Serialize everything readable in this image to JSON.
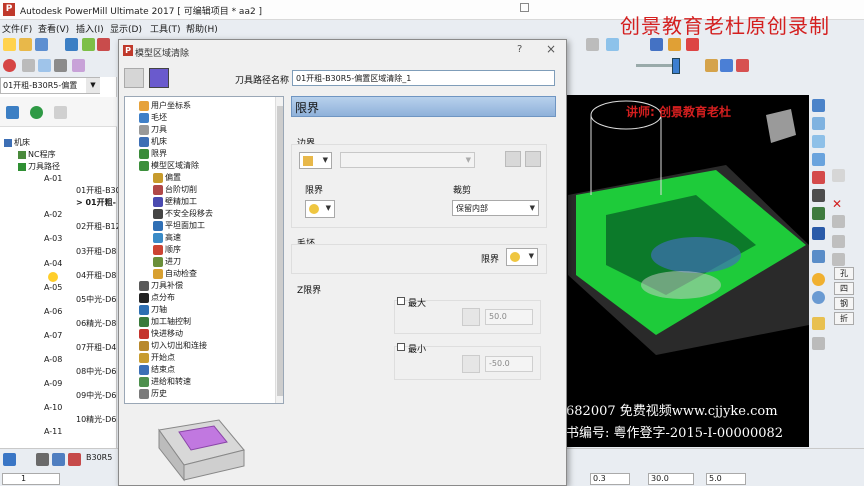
{
  "window": {
    "app_title": "Autodesk PowerMill Ultimate 2017   [ 可编辑项目 * aa2 ]",
    "watermark_title": "创景教育老杜原创录制"
  },
  "menu": [
    "文件(F)",
    "查看(V)",
    "插入(I)",
    "显示(D)",
    "工具(T)",
    "帮助(H)"
  ],
  "explorer": {
    "tool_selected": "01开粗-B30R5-偏置",
    "items": [
      {
        "label": "机床"
      },
      {
        "label": "NC程序"
      },
      {
        "label": "刀具路径"
      },
      {
        "label": "A-01"
      },
      {
        "label": "01开粗-B30"
      },
      {
        "label": "> 01开粗-"
      },
      {
        "label": "A-02"
      },
      {
        "label": "02开粗-B12"
      },
      {
        "label": "A-03"
      },
      {
        "label": "03开粗-D8"
      },
      {
        "label": "A-04"
      },
      {
        "label": "04开粗-D8"
      },
      {
        "label": "A-05"
      },
      {
        "label": "05中光-D6"
      },
      {
        "label": "A-06"
      },
      {
        "label": "06精光-D8"
      },
      {
        "label": "A-07"
      },
      {
        "label": "07开粗-D4"
      },
      {
        "label": "A-08"
      },
      {
        "label": "08中光-D6"
      },
      {
        "label": "A-09"
      },
      {
        "label": "09中光-D6"
      },
      {
        "label": "A-10"
      },
      {
        "label": "10精光-D6"
      },
      {
        "label": "A-11"
      }
    ]
  },
  "dialog": {
    "title": "模型区域清除",
    "help": "?",
    "close": "×",
    "path_name_label": "刀具路径名称",
    "path_name_value": "01开粗-B30R5-偏置区域清除_1",
    "page_title": "限界",
    "boundary_section": "边界",
    "limit_label": "限界",
    "trim_label": "裁剪",
    "trim_value": "保留内部",
    "block_section": "毛坯",
    "block_limit_label": "限界",
    "z_section": "Z限界",
    "max_label": "最大",
    "max_value": "50.0",
    "min_label": "最小",
    "min_value": "-50.0",
    "nav_tree": [
      "用户坐标系",
      "毛坯",
      "刀具",
      "机床",
      "限界",
      "模型区域清除",
      "偏置",
      "台阶切削",
      "壁精加工",
      "不安全段移去",
      "平坦面加工",
      "高速",
      "顺序",
      "进刀",
      "自动检查",
      "刀具补偿",
      "点分布",
      "刀轴",
      "加工轴控制",
      "快进移动",
      "切入切出和连接",
      "开始点",
      "结束点",
      "进给和转速",
      "历史"
    ]
  },
  "viewport": {
    "teacher": "讲师: 创景教育老杜",
    "site": "682007  免费视频www.cjjyke.com",
    "book": "书编号: 粤作登字-2015-I-00000082"
  },
  "right_bar": [
    "孔",
    "四",
    "钢",
    "折"
  ],
  "statusbar": {
    "tool_text": "B30R5",
    "num1": "1",
    "val1": "0.3",
    "val2": "30.0",
    "val3": "5.0"
  }
}
